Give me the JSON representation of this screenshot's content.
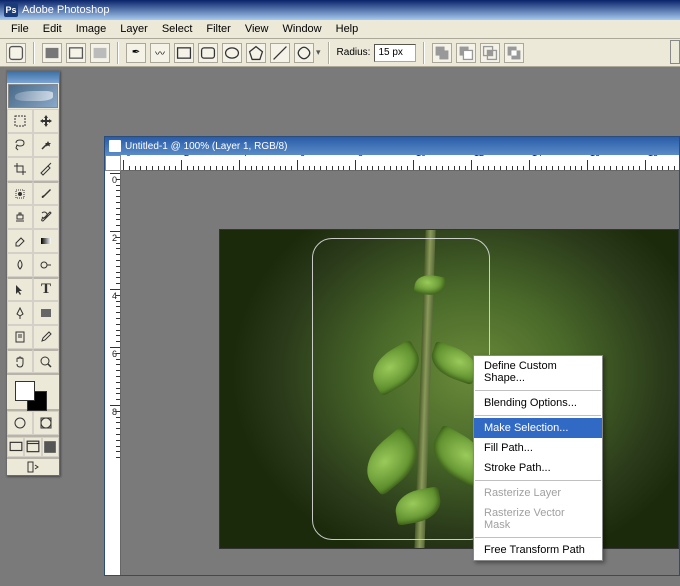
{
  "app": {
    "title": "Adobe Photoshop",
    "icon_label": "ps-icon"
  },
  "menu": {
    "items": [
      "File",
      "Edit",
      "Image",
      "Layer",
      "Select",
      "Filter",
      "View",
      "Window",
      "Help"
    ]
  },
  "options": {
    "radius_label": "Radius:",
    "radius_value": "15 px",
    "shape_icons": [
      "rect-shape",
      "rounded-rect-shape",
      "ellipse-shape",
      "polygon-shape",
      "line-shape",
      "custom-shape"
    ],
    "mode_icons": [
      "shape-layers-mode",
      "paths-mode",
      "fill-pixels-mode"
    ],
    "style_icons": [
      "style-a",
      "style-b",
      "style-c",
      "style-d"
    ]
  },
  "document": {
    "title": "Untitled-1 @ 100% (Layer 1, RGB/8)",
    "ruler_h": [
      "0",
      "2",
      "4",
      "6",
      "8",
      "10",
      "12",
      "14",
      "16",
      "18"
    ],
    "ruler_v": [
      "0",
      "2",
      "4",
      "6",
      "8"
    ]
  },
  "context_menu": {
    "items": [
      {
        "label": "Define Custom Shape...",
        "enabled": true,
        "hl": false
      },
      {
        "sep": true
      },
      {
        "label": "Blending Options...",
        "enabled": true,
        "hl": false
      },
      {
        "sep": true
      },
      {
        "label": "Make Selection...",
        "enabled": true,
        "hl": true
      },
      {
        "label": "Fill Path...",
        "enabled": true,
        "hl": false
      },
      {
        "label": "Stroke Path...",
        "enabled": true,
        "hl": false
      },
      {
        "sep": true
      },
      {
        "label": "Rasterize Layer",
        "enabled": false,
        "hl": false
      },
      {
        "label": "Rasterize Vector Mask",
        "enabled": false,
        "hl": false
      },
      {
        "sep": true
      },
      {
        "label": "Free Transform Path",
        "enabled": true,
        "hl": false
      }
    ]
  },
  "toolbox": {
    "tools": [
      "rectangular-marquee",
      "move",
      "lasso",
      "magic-wand",
      "crop",
      "slice",
      "healing-brush",
      "brush",
      "clone-stamp",
      "history-brush",
      "eraser",
      "gradient",
      "blur",
      "dodge",
      "path-selection",
      "type",
      "pen",
      "rectangle",
      "notes",
      "eyedropper",
      "hand",
      "zoom"
    ],
    "colors": {
      "fg": "#ffffff",
      "bg": "#000000"
    },
    "modes": [
      "standard-mode",
      "quickmask-mode",
      "screen-std",
      "screen-full-menu",
      "screen-full"
    ]
  }
}
